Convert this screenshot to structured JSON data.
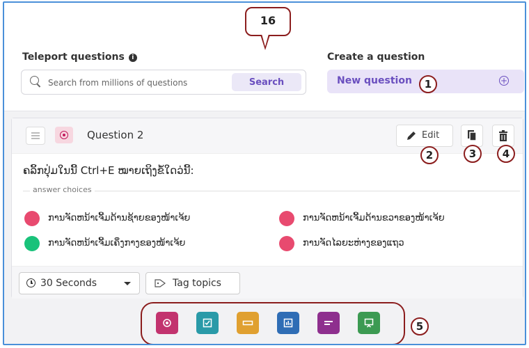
{
  "callouts": [
    "16",
    "1",
    "2",
    "3",
    "4",
    "5"
  ],
  "teleport": {
    "label": "Teleport questions",
    "search_placeholder": "Search from millions of questions",
    "search_button": "Search"
  },
  "create": {
    "label": "Create a question",
    "new_question": "New question"
  },
  "question": {
    "title": "Question 2",
    "edit_label": "Edit",
    "text": "ຄລິ້ກປຸ່ມໃນນີ້ Ctrl+E ໝາຍເຖິງຂໍ້ໃດວ່ນີ້:",
    "answer_choices_label": "answer choices",
    "choices": [
      {
        "text": "ການຈັດຫນ້າເຈີ້ມດ້ານຊ້າຍຂອງໜ້າເຈ້ຍ",
        "color": "#e84a6f",
        "correct": false
      },
      {
        "text": "ການຈັດຫນ້າເຈີ້ມດ້ານຂວາຂອງໜ້າເຈ້ຍ",
        "color": "#e84a6f",
        "correct": false
      },
      {
        "text": "ການຈັດຫນ້າເຈີ້ມເຄິ່ງກາງຂອງໜ້າເຈ້ຍ",
        "color": "#19c27a",
        "correct": true
      },
      {
        "text": "ການຈັດໄລຍະຫ່າງຂອງແຖວ",
        "color": "#e84a6f",
        "correct": false
      }
    ],
    "timer": "30 Seconds",
    "tag_topics": "Tag topics"
  },
  "type_toolbar": [
    {
      "name": "multiple-choice",
      "color": "#c2336e"
    },
    {
      "name": "checkbox",
      "color": "#2a9aa8"
    },
    {
      "name": "fill-in-blank",
      "color": "#e0a030"
    },
    {
      "name": "poll",
      "color": "#2f6db5"
    },
    {
      "name": "open-ended",
      "color": "#8e2f8e"
    },
    {
      "name": "slide",
      "color": "#3c9a52"
    }
  ]
}
